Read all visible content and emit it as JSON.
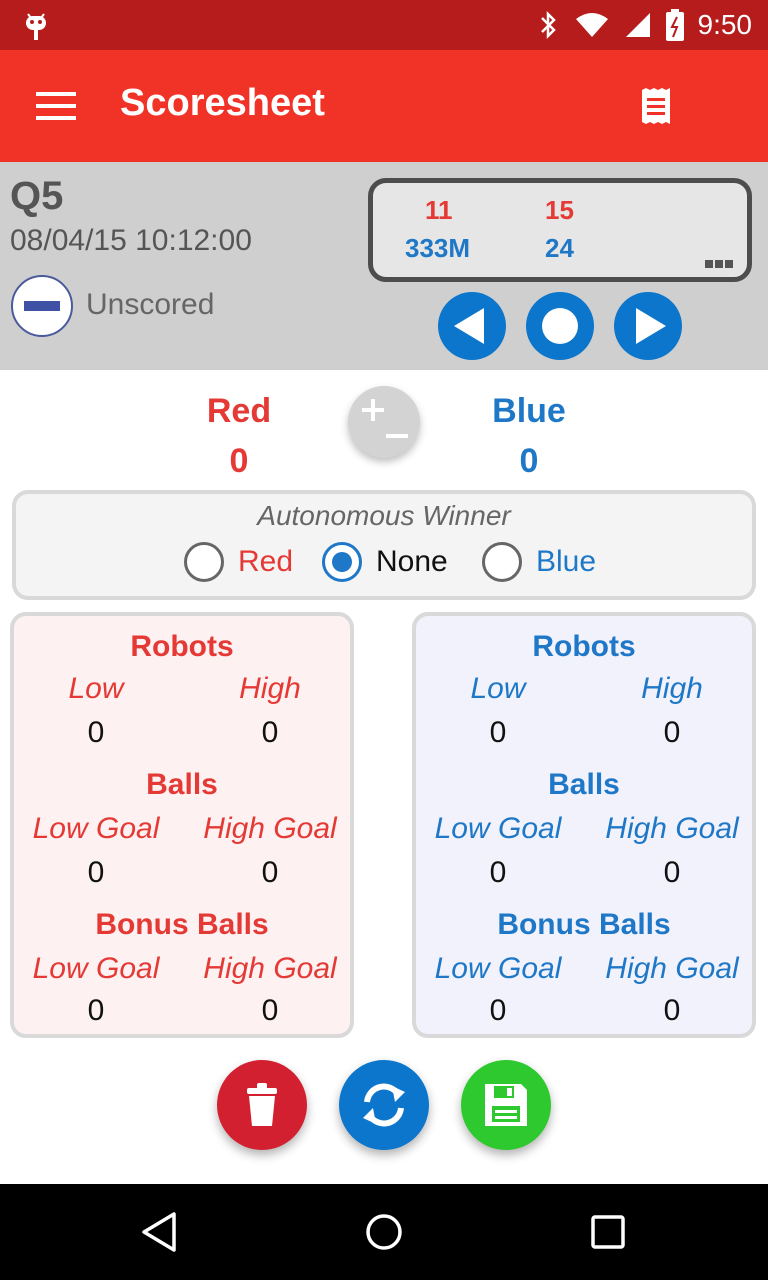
{
  "status_bar": {
    "time": "9:50"
  },
  "app_bar": {
    "title": "Scoresheet"
  },
  "match": {
    "id": "Q5",
    "datetime": "08/04/15 10:12:00",
    "status": "Unscored",
    "red_teams": [
      "11",
      "15"
    ],
    "blue_teams": [
      "333M",
      "24"
    ]
  },
  "score": {
    "red_label": "Red",
    "red_score": "0",
    "blue_label": "Blue",
    "blue_score": "0"
  },
  "autonomous": {
    "title": "Autonomous Winner",
    "options": [
      "Red",
      "None",
      "Blue"
    ],
    "selected": "None"
  },
  "panels": {
    "red": {
      "robots": "Robots",
      "low": "Low",
      "high": "High",
      "robots_low": "0",
      "robots_high": "0",
      "balls": "Balls",
      "low_goal": "Low Goal",
      "high_goal": "High Goal",
      "balls_low": "0",
      "balls_high": "0",
      "bonus": "Bonus Balls",
      "bonus_low_goal": "Low Goal",
      "bonus_high_goal": "High Goal",
      "bonus_low": "0",
      "bonus_high": "0"
    },
    "blue": {
      "robots": "Robots",
      "low": "Low",
      "high": "High",
      "robots_low": "0",
      "robots_high": "0",
      "balls": "Balls",
      "low_goal": "Low Goal",
      "high_goal": "High Goal",
      "balls_low": "0",
      "balls_high": "0",
      "bonus": "Bonus Balls",
      "bonus_low_goal": "Low Goal",
      "bonus_high_goal": "High Goal",
      "bonus_low": "0",
      "bonus_high": "0"
    }
  },
  "colors": {
    "red": "#e53935",
    "blue": "#1e78c7",
    "app_bar": "#f03227",
    "status_bar": "#b71c1c"
  }
}
